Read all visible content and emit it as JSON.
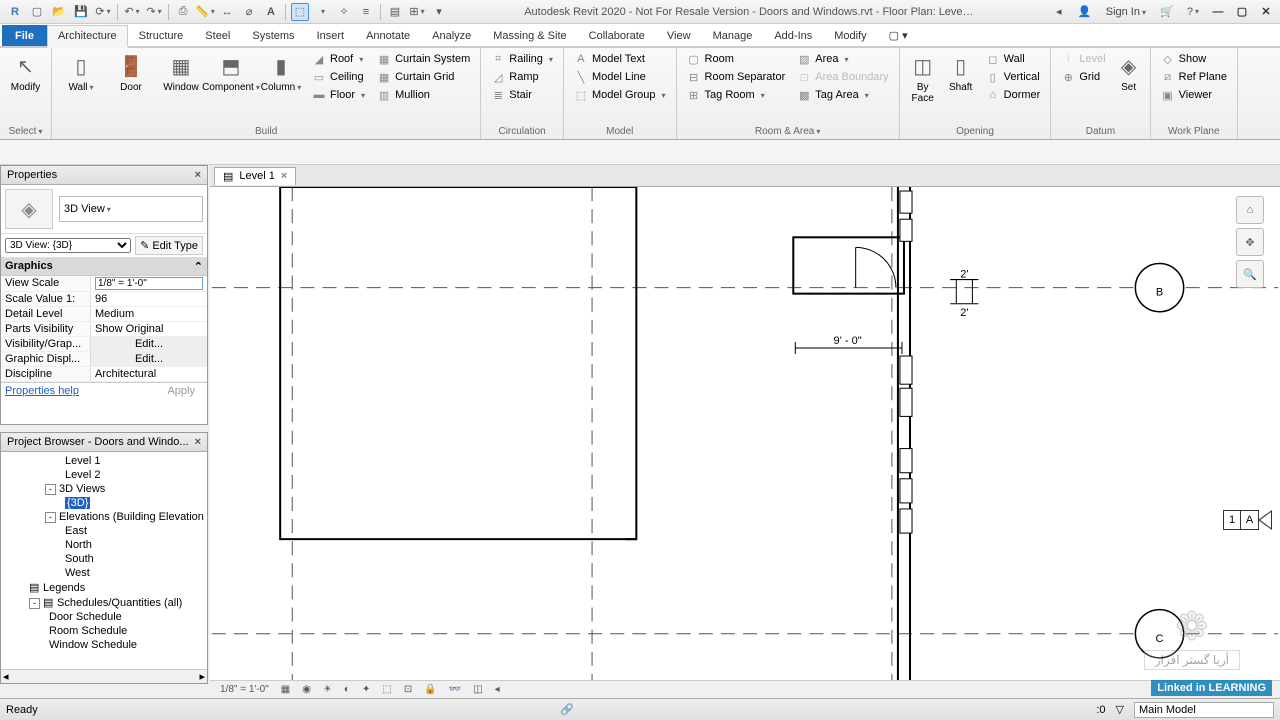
{
  "title": "Autodesk Revit 2020 - Not For Resale Version - Doors and Windows.rvt - Floor Plan: Leve…",
  "signin": "Sign In",
  "tabs": [
    "File",
    "Architecture",
    "Structure",
    "Steel",
    "Systems",
    "Insert",
    "Annotate",
    "Analyze",
    "Massing & Site",
    "Collaborate",
    "View",
    "Manage",
    "Add-Ins",
    "Modify"
  ],
  "active_tab": "Architecture",
  "panels": {
    "select": {
      "modify": "Modify",
      "select": "Select"
    },
    "build": {
      "label": "Build",
      "wall": "Wall",
      "door": "Door",
      "window": "Window",
      "component": "Component",
      "column": "Column",
      "roof": "Roof",
      "ceiling": "Ceiling",
      "floor": "Floor",
      "curtain_system": "Curtain System",
      "curtain_grid": "Curtain Grid",
      "mullion": "Mullion"
    },
    "circulation": {
      "label": "Circulation",
      "railing": "Railing",
      "ramp": "Ramp",
      "stair": "Stair"
    },
    "model": {
      "label": "Model",
      "text": "Model Text",
      "line": "Model Line",
      "group": "Model Group"
    },
    "room_area": {
      "label": "Room & Area",
      "room": "Room",
      "sep": "Room Separator",
      "tag_room": "Tag Room",
      "area": "Area",
      "area_boundary": "Area Boundary",
      "tag_area": "Tag Area"
    },
    "opening": {
      "label": "Opening",
      "by_face": "By Face",
      "shaft": "Shaft",
      "wall": "Wall",
      "vertical": "Vertical",
      "dormer": "Dormer"
    },
    "datum": {
      "label": "Datum",
      "level": "Level",
      "grid": "Grid",
      "set": "Set"
    },
    "workplane": {
      "label": "Work Plane",
      "show": "Show",
      "ref": "Ref Plane",
      "viewer": "Viewer"
    }
  },
  "properties": {
    "title": "Properties",
    "type_selector": "3D View",
    "instance": "3D View: {3D}",
    "edit_type": "Edit Type",
    "group": "Graphics",
    "rows": [
      {
        "k": "View Scale",
        "v": "1/8\" = 1'-0\"",
        "input": true
      },
      {
        "k": "Scale Value    1:",
        "v": "96"
      },
      {
        "k": "Detail Level",
        "v": "Medium"
      },
      {
        "k": "Parts Visibility",
        "v": "Show Original"
      },
      {
        "k": "Visibility/Grap...",
        "v": "Edit...",
        "btn": true
      },
      {
        "k": "Graphic Displ...",
        "v": "Edit...",
        "btn": true
      },
      {
        "k": "Discipline",
        "v": "Architectural"
      }
    ],
    "help": "Properties help",
    "apply": "Apply"
  },
  "browser": {
    "title": "Project Browser - Doors and Windo...",
    "items": [
      {
        "label": "Level 1",
        "indent": 64
      },
      {
        "label": "Level 2",
        "indent": 64
      },
      {
        "label": "3D Views",
        "indent": 44,
        "exp": "-"
      },
      {
        "label": "{3D}",
        "indent": 64,
        "sel": true
      },
      {
        "label": "Elevations (Building Elevation",
        "indent": 44,
        "exp": "-"
      },
      {
        "label": "East",
        "indent": 64
      },
      {
        "label": "North",
        "indent": 64
      },
      {
        "label": "South",
        "indent": 64
      },
      {
        "label": "West",
        "indent": 64
      },
      {
        "label": "Legends",
        "indent": 28,
        "icon": true
      },
      {
        "label": "Schedules/Quantities (all)",
        "indent": 28,
        "exp": "-",
        "icon": true
      },
      {
        "label": "Door Schedule",
        "indent": 48
      },
      {
        "label": "Room Schedule",
        "indent": 48
      },
      {
        "label": "Window Schedule",
        "indent": 48
      }
    ]
  },
  "view_tab": {
    "name": "Level 1"
  },
  "drawing": {
    "grid_b": "B",
    "grid_c": "C",
    "dim": "9' - 0\"",
    "dim2a": "2'",
    "dim2b": "2'",
    "section": {
      "num": "1",
      "sheet": "A"
    }
  },
  "viewbar_scale": "1/8\" = 1'-0\"",
  "status": {
    "ready": "Ready",
    "sel": ":0",
    "ws": "Main Model"
  },
  "watermark": {
    "line1": "✿",
    "line2": "أريا گستر افزار"
  },
  "linkedin": "Linked in LEARNING"
}
